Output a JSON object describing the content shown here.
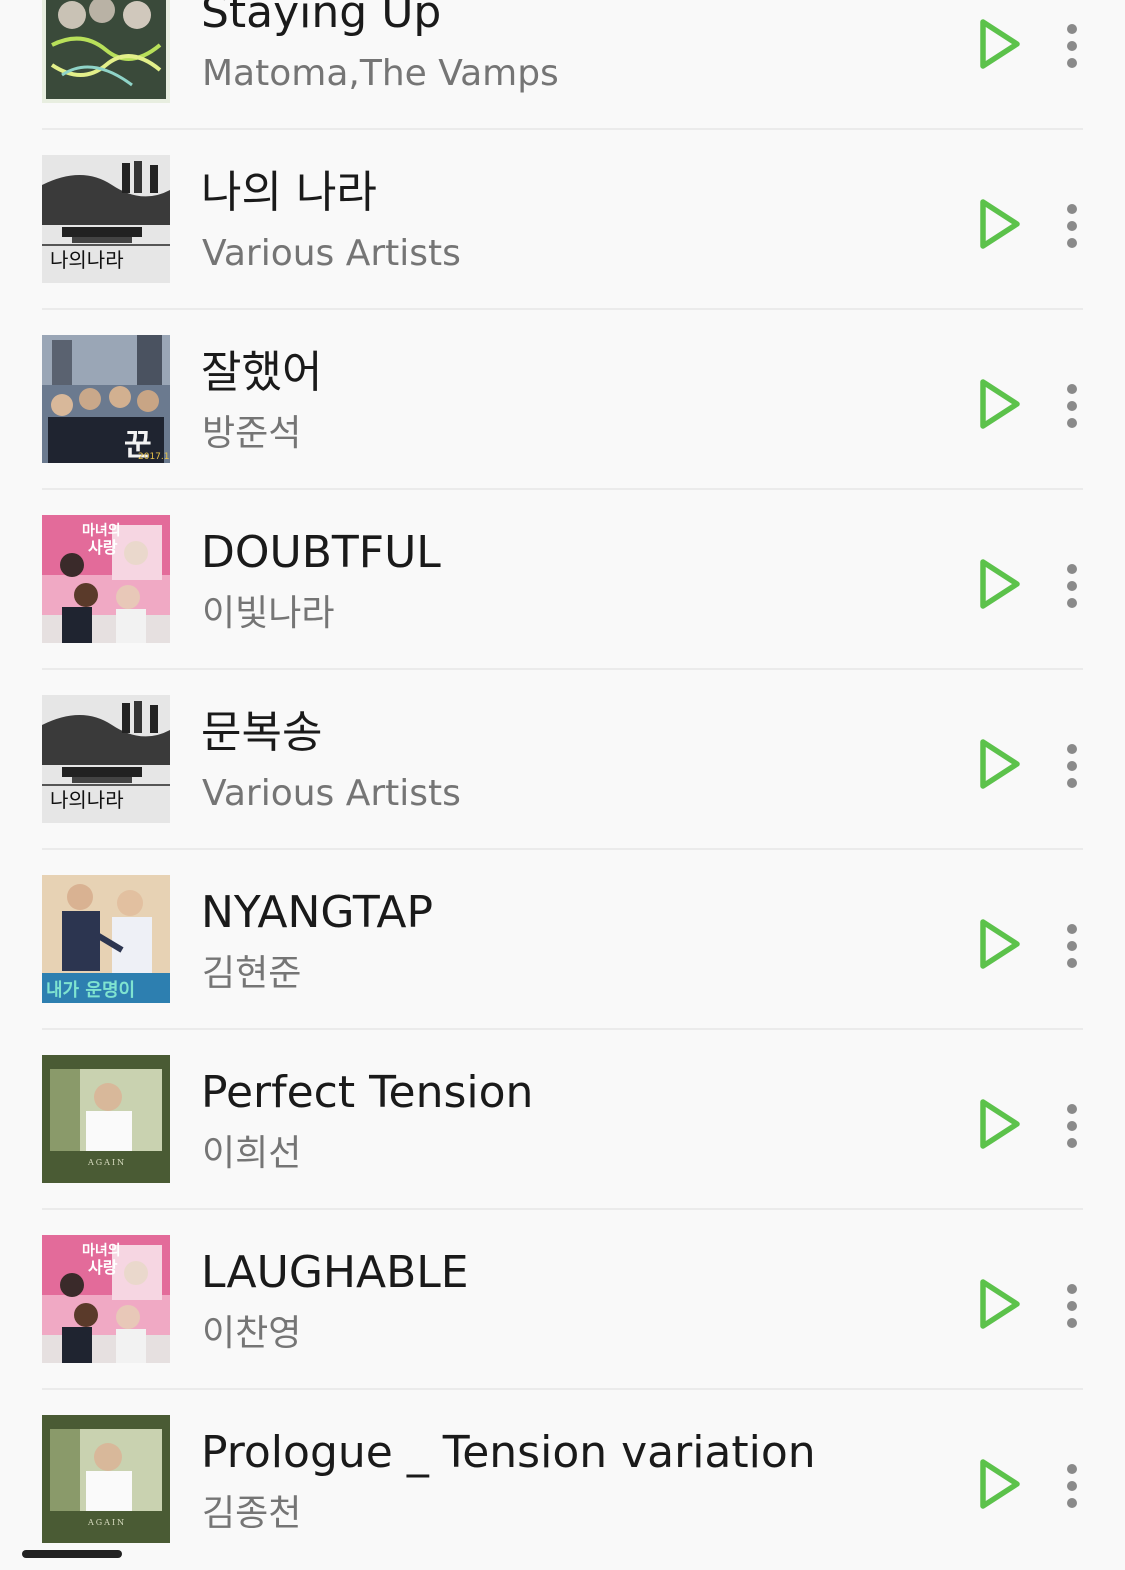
{
  "theme": {
    "accent": "#5cc24b",
    "title_color": "#1a1a1a",
    "artist_color": "#757575",
    "background": "#f9f9f9"
  },
  "songs": [
    {
      "title": "Staying Up",
      "artist": "Matoma,The Vamps",
      "art": "album-art-staying-up"
    },
    {
      "title": "나의 나라",
      "artist": "Various Artists",
      "art": "album-art-my-country"
    },
    {
      "title": "잘했어",
      "artist": "방준석",
      "art": "album-art-kkun"
    },
    {
      "title": "DOUBTFUL",
      "artist": "이빛나라",
      "art": "album-art-witch-love"
    },
    {
      "title": "문복송",
      "artist": "Various Artists",
      "art": "album-art-my-country"
    },
    {
      "title": "NYANGTAP",
      "artist": "김현준",
      "art": "album-art-fate"
    },
    {
      "title": "Perfect Tension",
      "artist": "이희선",
      "art": "album-art-again"
    },
    {
      "title": "LAUGHABLE",
      "artist": "이찬영",
      "art": "album-art-witch-love"
    },
    {
      "title": "Prologue _ Tension variation",
      "artist": "김종천",
      "art": "album-art-again"
    }
  ],
  "icons": {
    "play": "play-icon",
    "more": "more-vertical-icon"
  }
}
